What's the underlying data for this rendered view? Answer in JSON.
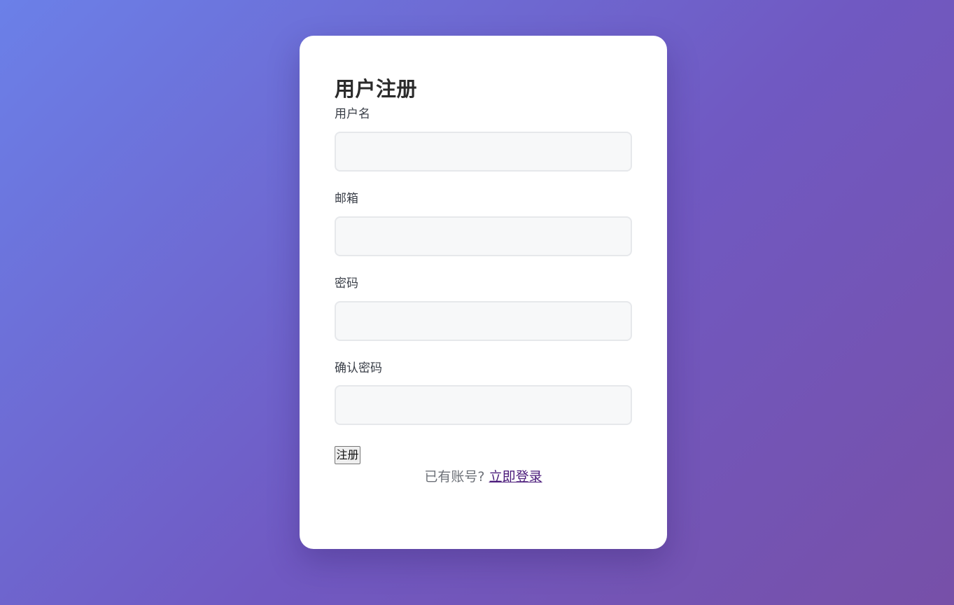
{
  "form": {
    "title": "用户注册",
    "fields": [
      {
        "label": "用户名",
        "value": "",
        "placeholder": ""
      },
      {
        "label": "邮箱",
        "value": "",
        "placeholder": ""
      },
      {
        "label": "密码",
        "value": "",
        "placeholder": ""
      },
      {
        "label": "确认密码",
        "value": "",
        "placeholder": ""
      }
    ],
    "submit_label": "注册",
    "footer": {
      "prompt": "已有账号?",
      "login_link": "立即登录"
    }
  },
  "colors": {
    "gradient_start": "#6b80e8",
    "gradient_end": "#7750a8",
    "card_background": "#ffffff",
    "input_background": "#f7f8f9",
    "link": "#4a1a7a"
  }
}
